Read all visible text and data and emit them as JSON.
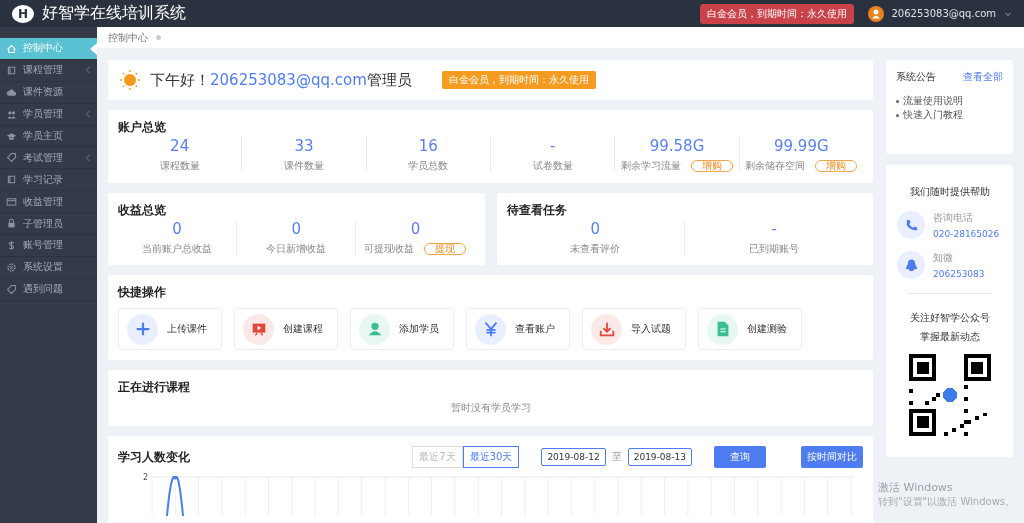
{
  "header": {
    "logo_letter": "H",
    "title": "好智学在线培训系统",
    "membership_badge": "白金会员，到期时间：永久使用",
    "user_email": "206253083@qq.com"
  },
  "sidebar": {
    "items": [
      {
        "label": "控制中心",
        "submenu": false,
        "selected": true
      },
      {
        "label": "课程管理",
        "submenu": true,
        "selected": false
      },
      {
        "label": "课件资源",
        "submenu": false,
        "selected": false
      },
      {
        "label": "学员管理",
        "submenu": true,
        "selected": false
      },
      {
        "label": "学员主页",
        "submenu": false,
        "selected": false
      },
      {
        "label": "考试管理",
        "submenu": true,
        "selected": false
      },
      {
        "label": "学习记录",
        "submenu": false,
        "selected": false
      },
      {
        "label": "收益管理",
        "submenu": false,
        "selected": false
      },
      {
        "label": "子管理员",
        "submenu": false,
        "selected": false
      },
      {
        "label": "账号管理",
        "submenu": false,
        "selected": false
      },
      {
        "label": "系统设置",
        "submenu": false,
        "selected": false
      },
      {
        "label": "遇到问题",
        "submenu": false,
        "selected": false
      }
    ]
  },
  "breadcrumb": "控制中心",
  "greeting": {
    "text": "下午好！",
    "user": "206253083@qq.com",
    "role": "管理员",
    "badge": "白金会员，到期时间：永久使用"
  },
  "account_overview": {
    "title": "账户总览",
    "stats": [
      {
        "value": "24",
        "label": "课程数量"
      },
      {
        "value": "33",
        "label": "课件数量"
      },
      {
        "value": "16",
        "label": "学员总数"
      },
      {
        "value": "-",
        "label": "试卷数量"
      },
      {
        "value": "99.58G",
        "label": "剩余学习流量",
        "action": "增购"
      },
      {
        "value": "99.99G",
        "label": "剩余储存空间",
        "action": "增购"
      }
    ]
  },
  "income_overview": {
    "title": "收益总览",
    "stats": [
      {
        "value": "0",
        "label": "当前账户总收益"
      },
      {
        "value": "0",
        "label": "今日新增收益"
      },
      {
        "value": "0",
        "label": "可提现收益",
        "action": "提现"
      }
    ]
  },
  "pending_tasks": {
    "title": "待查看任务",
    "stats": [
      {
        "value": "0",
        "label": "未查看评价"
      },
      {
        "value": "-",
        "label": "已到期账号"
      }
    ]
  },
  "quick_actions": {
    "title": "快捷操作",
    "items": [
      {
        "label": "上传课件",
        "color": "#4a7cf6"
      },
      {
        "label": "创建课程",
        "color": "#e0483d"
      },
      {
        "label": "添加学员",
        "color": "#3bbf8f"
      },
      {
        "label": "查看账户",
        "color": "#4a7cf6"
      },
      {
        "label": "导入试题",
        "color": "#e0483d"
      },
      {
        "label": "创建测验",
        "color": "#3bbf8f"
      }
    ]
  },
  "ongoing_courses": {
    "title": "正在进行课程",
    "empty_text": "暂时没有学员学习"
  },
  "learners_chart": {
    "title": "学习人数变化",
    "ranges": [
      {
        "label": "最近7天",
        "selected": false
      },
      {
        "label": "最近30天",
        "selected": true
      }
    ],
    "date_from": "2019-08-12",
    "separator": "至",
    "date_to": "2019-08-13",
    "query_button": "查询",
    "compare_button": "按时间对比",
    "y_tick_label": "2"
  },
  "announcements": {
    "title": "系统公告",
    "view_all": "查看全部",
    "items": [
      "流量使用说明",
      "快速入门教程"
    ]
  },
  "help": {
    "title": "我们随时提供帮助",
    "contacts": [
      {
        "label": "咨询电话",
        "value": "020-28165026"
      },
      {
        "label": "知微",
        "value": "206253083"
      }
    ],
    "follow_lines": [
      "关注好智学公众号",
      "掌握最新动态"
    ]
  },
  "os_notice": {
    "title": "激活 Windows",
    "text": "转到\"设置\"以激活 Windows。"
  }
}
